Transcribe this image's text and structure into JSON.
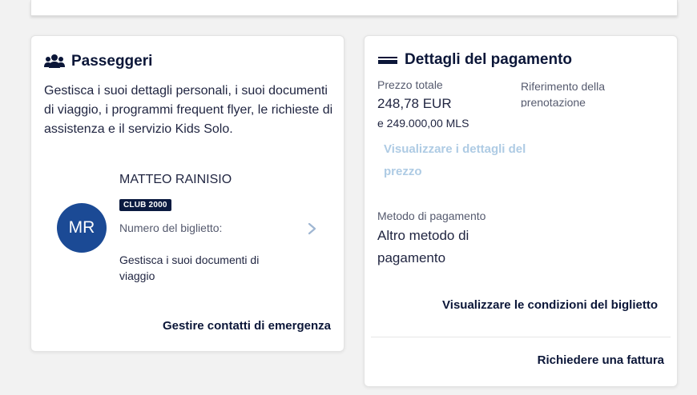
{
  "passengers": {
    "title": "Passeggeri",
    "icon": "users-icon",
    "description": "Gestisca i suoi dettagli personali, i suoi documenti di viaggio, i programmi frequent flyer, le richieste di assistenza e il servizio Kids Solo.",
    "passenger": {
      "initials": "MR",
      "name": "MATTEO RAINISIO",
      "badge": "CLUB 2000",
      "ticket_label": "Numero del biglietto:",
      "documents_text": "Gestisca i suoi documenti di viaggio"
    },
    "emergency_link": "Gestire contatti di emergenza"
  },
  "payment": {
    "title": "Dettagli del pagamento",
    "icon": "credit-card-icon",
    "total_label": "Prezzo totale",
    "total_amount": "248,78 EUR",
    "miles": "e 249.000,00 MLS",
    "reference_label": "Riferimento della prenotazione",
    "view_price_link": "Visualizzare i dettagli del prezzo",
    "method_label": "Metodo di pagamento",
    "method_value": "Altro metodo di pagamento",
    "conditions_link": "Visualizzare le condizioni del biglietto",
    "invoice_link": "Richiedere una fattura"
  },
  "colors": {
    "navy": "#0b1638",
    "avatar_blue": "#1b4a95",
    "disabled_link": "#aecbe4"
  }
}
